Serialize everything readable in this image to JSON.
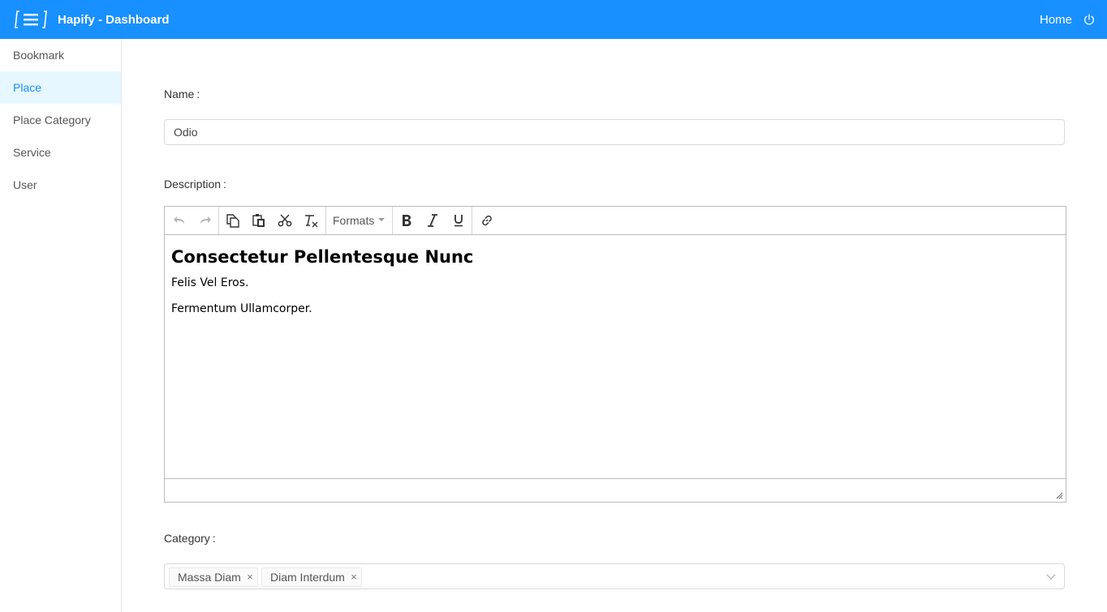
{
  "app": {
    "title": "Hapify - Dashboard",
    "home_label": "Home"
  },
  "icons": {
    "logo": "menu-icon",
    "power": "power-icon"
  },
  "colors": {
    "primary": "#1890ff",
    "active_bg": "#e6f7ff"
  },
  "sidebar": {
    "items": [
      {
        "label": "Bookmark",
        "active": false
      },
      {
        "label": "Place",
        "active": true
      },
      {
        "label": "Place Category",
        "active": false
      },
      {
        "label": "Service",
        "active": false
      },
      {
        "label": "User",
        "active": false
      }
    ]
  },
  "form": {
    "name_label": "Name",
    "name_value": "Odio",
    "description_label": "Description",
    "category_label": "Category",
    "colon": ":"
  },
  "editor": {
    "toolbar": {
      "formats_label": "Formats",
      "buttons": [
        "undo-icon",
        "redo-icon",
        "copy-icon",
        "paste-icon",
        "cut-icon",
        "clear-formatting-icon",
        "bold-icon",
        "italic-icon",
        "underline-icon",
        "link-icon"
      ]
    },
    "content": {
      "heading": "Consectetur Pellentesque Nunc",
      "paragraphs": [
        "Felis Vel Eros.",
        "Fermentum Ullamcorper."
      ]
    }
  },
  "category": {
    "tags": [
      "Massa Diam",
      "Diam Interdum"
    ],
    "remove_symbol": "×"
  }
}
